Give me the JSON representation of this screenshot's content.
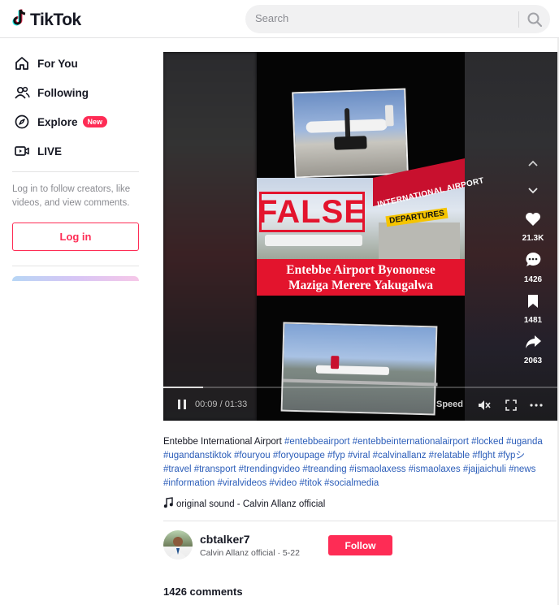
{
  "header": {
    "logo_text": "TikTok",
    "search_placeholder": "Search"
  },
  "sidebar": {
    "items": [
      {
        "label": "For You",
        "icon": "home-icon"
      },
      {
        "label": "Following",
        "icon": "users-icon"
      },
      {
        "label": "Explore",
        "icon": "compass-icon",
        "badge": "New"
      },
      {
        "label": "LIVE",
        "icon": "live-icon"
      }
    ],
    "login_hint": "Log in to follow creators, like videos, and view comments.",
    "login_label": "Log in"
  },
  "video": {
    "overlay_stamp": "FALSE",
    "airport_sign": "INTERNATIONAL AIRPORT",
    "departures_sign": "DEPARTURES",
    "caption_line1": "Entebbe Airport Byononese",
    "caption_line2": "Maziga Merere Yakugalwa",
    "time": "00:09 / 01:33",
    "progress": 0.1,
    "speed_label": "Speed",
    "likes": "21.3K",
    "comments": "1426",
    "saves": "1481",
    "shares": "2063"
  },
  "post": {
    "description_text": "Entebbe International Airport",
    "hashtags": "#entebbeairport #entebbeinternationalairport #locked #uganda #ugandanstiktok #fouryou #foryoupage #fyp #viral #calvinallanz #relatable #flght #fypシ #travel #transport #trendingvideo #treanding #ismaolaxess #ismaolaxes #jajjaichuli #news #information #viralvideos #video #titok #socialmedia",
    "sound": "original sound - Calvin Allanz official",
    "author_handle": "cbtalker7",
    "author_sub": "Calvin Allanz official · 5-22",
    "follow_label": "Follow",
    "comments_count": "1426 comments"
  },
  "colors": {
    "brand": "#fe2c55",
    "hashtag": "#2b5db9",
    "stamp_red": "#e3142d"
  }
}
